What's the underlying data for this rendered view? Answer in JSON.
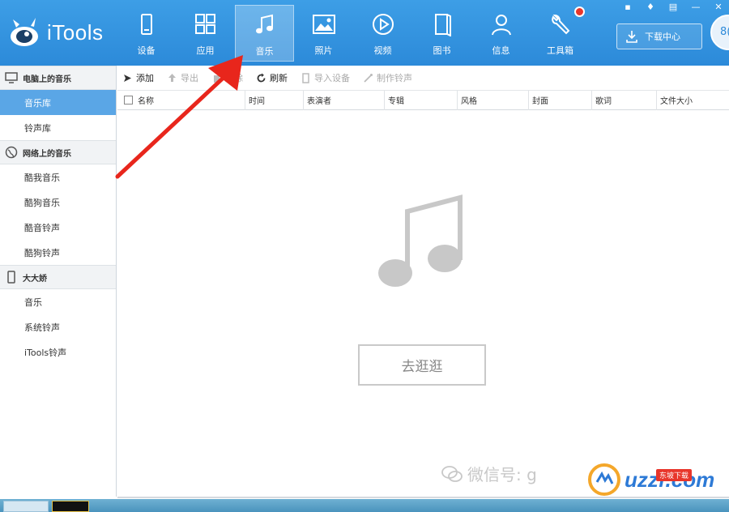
{
  "app": {
    "name": "iTools"
  },
  "nav": [
    {
      "id": "device",
      "label": "设备",
      "icon": "device-icon"
    },
    {
      "id": "apps",
      "label": "应用",
      "icon": "apps-grid-icon"
    },
    {
      "id": "music",
      "label": "音乐",
      "icon": "music-note-icon",
      "active": true
    },
    {
      "id": "photos",
      "label": "照片",
      "icon": "photo-icon"
    },
    {
      "id": "video",
      "label": "视频",
      "icon": "play-icon"
    },
    {
      "id": "books",
      "label": "图书",
      "icon": "book-icon"
    },
    {
      "id": "info",
      "label": "信息",
      "icon": "person-icon"
    },
    {
      "id": "toolbox",
      "label": "工具箱",
      "icon": "wrench-icon"
    }
  ],
  "header": {
    "download_label": "下载中心",
    "avatar_text": "8("
  },
  "sidebar": {
    "group1": {
      "label": "电脑上的音乐",
      "items": [
        "音乐库",
        "铃声库"
      ]
    },
    "group2": {
      "label": "网络上的音乐",
      "items": [
        "酷我音乐",
        "酷狗音乐",
        "酷音铃声",
        "酷狗铃声"
      ]
    },
    "group3": {
      "label": "大大娇",
      "items": [
        "音乐",
        "系统铃声",
        "iTools铃声"
      ]
    }
  },
  "toolbar": {
    "add": "添加",
    "export": "导出",
    "delete": "删除",
    "refresh": "刷新",
    "import_device": "导入设备",
    "make_ringtone": "制作铃声"
  },
  "table": {
    "columns": [
      "名称",
      "时间",
      "表演者",
      "专辑",
      "风格",
      "封面",
      "歌词",
      "文件大小"
    ]
  },
  "content": {
    "go_button": "去逛逛"
  },
  "watermark": {
    "wechat": "微信号: g",
    "site": "uzzf.com",
    "badge": "东坡下载"
  },
  "colors": {
    "header_blue": "#2c8ad9",
    "active_sidebar": "#5aa6e6",
    "notification_red": "#e8362b"
  }
}
